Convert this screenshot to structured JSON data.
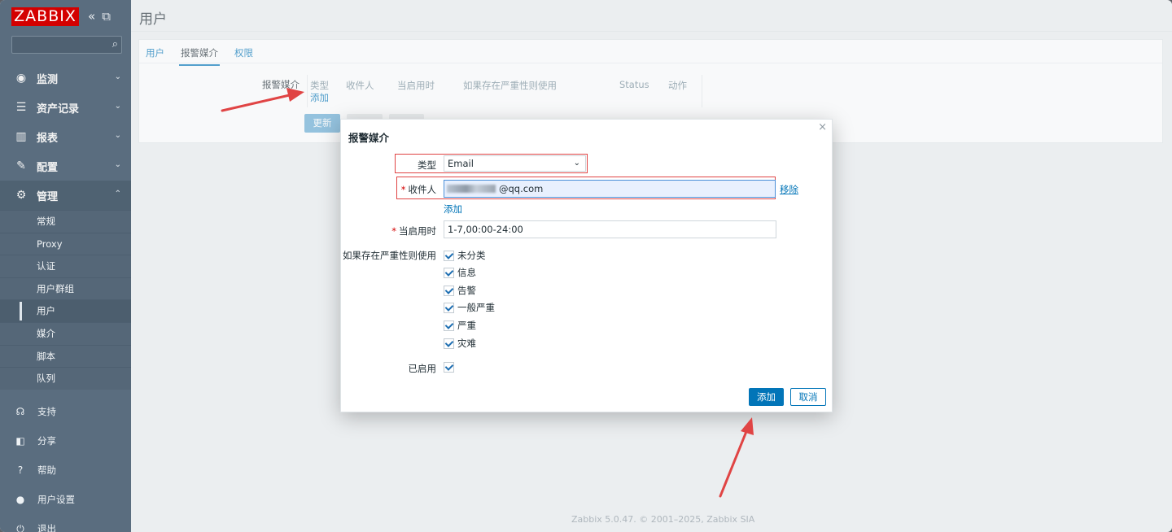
{
  "colors": {
    "sidebar": "#5a6d7f",
    "brand": "#d40000",
    "link": "#0275b8",
    "annotation": "#e04444"
  },
  "sidebar": {
    "logo": "ZABBIX",
    "tools": {
      "collapse_icon": "collapse-icon",
      "kiosk_icon": "kiosk-icon"
    },
    "search": {
      "placeholder": "",
      "icon": "search-icon"
    },
    "menu": [
      {
        "label": "监测",
        "icon": "eye-icon"
      },
      {
        "label": "资产记录",
        "icon": "list-icon"
      },
      {
        "label": "报表",
        "icon": "chart-icon"
      },
      {
        "label": "配置",
        "icon": "wrench-icon"
      },
      {
        "label": "管理",
        "icon": "gear-icon"
      }
    ],
    "submenu": [
      "常规",
      "Proxy",
      "认证",
      "用户群组",
      "用户",
      "媒介",
      "脚本",
      "队列"
    ],
    "bottom": [
      {
        "label": "支持",
        "icon": "headset-icon"
      },
      {
        "label": "分享",
        "icon": "share-icon"
      },
      {
        "label": "帮助",
        "icon": "help-icon"
      },
      {
        "label": "用户设置",
        "icon": "user-icon"
      },
      {
        "label": "退出",
        "icon": "power-icon"
      }
    ]
  },
  "page": {
    "title": "用户",
    "tabs": [
      "用户",
      "报警媒介",
      "权限"
    ],
    "media_label": "报警媒介",
    "media_table": {
      "columns": [
        "类型",
        "收件人",
        "当启用时",
        "如果存在严重性则使用",
        "Status",
        "动作"
      ],
      "add_link": "添加"
    },
    "update_button": "更新",
    "footer": "Zabbix 5.0.47. © 2001–2025, Zabbix SIA"
  },
  "dialog": {
    "title": "报警媒介",
    "close": "×",
    "type_label": "类型",
    "type_value": "Email",
    "recipient_label": "收件人",
    "recipient_value": "@qq.com",
    "remove_link": "移除",
    "add_link": "添加",
    "when_active_label": "当启用时",
    "when_active_value": "1-7,00:00-24:00",
    "severity_label": "如果存在严重性则使用",
    "severities": [
      "未分类",
      "信息",
      "告警",
      "一般严重",
      "严重",
      "灾难"
    ],
    "enabled_label": "已启用",
    "add_button": "添加",
    "cancel_button": "取消"
  }
}
